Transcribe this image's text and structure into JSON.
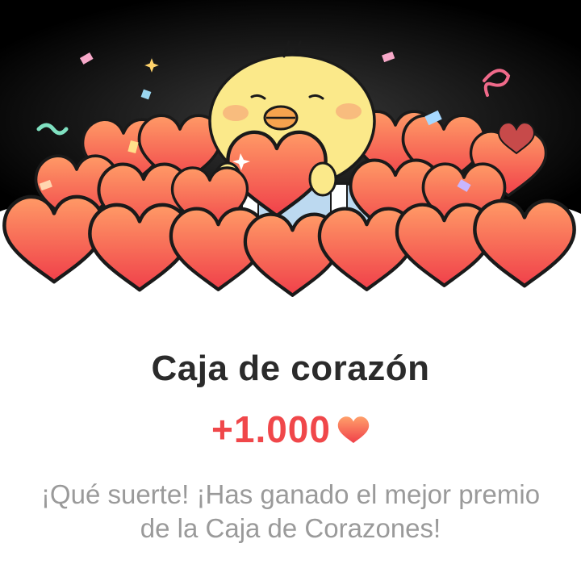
{
  "illustration": {
    "description_icon": "heart-box-chick-illustration",
    "colors": {
      "background_dark": "#000000",
      "heart_top": "#ff8a5c",
      "heart_bottom": "#f2454a",
      "chick": "#fbe98a",
      "beak": "#f6a34e"
    }
  },
  "card": {
    "title": "Caja de corazón",
    "reward_amount": "+1.000",
    "reward_icon": "heart-icon",
    "message": "¡Qué suerte! ¡Has ganado el mejor premio de la Caja de Corazones!"
  },
  "colors": {
    "title": "#2b2b2b",
    "reward": "#f0474a",
    "message": "#9a9a9a"
  }
}
